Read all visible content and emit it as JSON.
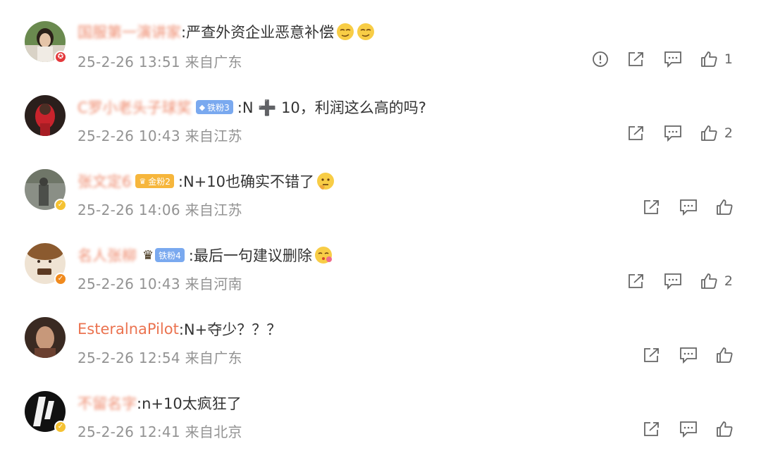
{
  "comments": [
    {
      "username": "国服第一演讲家",
      "fan_badge": "",
      "text": ":严查外资企业恶意补偿",
      "emojis": [
        "smirk",
        "smirk"
      ],
      "time": "25-2-26 13:51",
      "location": "来自广东",
      "report": true,
      "likes": "1",
      "avatar_badge": "red"
    },
    {
      "username": "C罗小老头子球奖",
      "fan_badge": "铁粉3",
      "text": ":N ➕ 10，利润这么高的吗?",
      "emojis": [],
      "time": "25-2-26 10:43",
      "location": "来自江苏",
      "report": false,
      "likes": "2",
      "avatar_badge": ""
    },
    {
      "username": "张文定6",
      "fan_badge": "金粉2",
      "text": ":N+10也确实不错了",
      "emojis": [
        "thinking"
      ],
      "time": "25-2-26 14:06",
      "location": "来自江苏",
      "report": false,
      "likes": "",
      "avatar_badge": "yellow"
    },
    {
      "username": "名人张柳",
      "fan_badge": "铁粉4",
      "text": ":最后一句建议删除",
      "emojis": [
        "kiss"
      ],
      "time": "25-2-26 10:43",
      "location": "来自河南",
      "report": false,
      "likes": "2",
      "avatar_badge": "orange"
    },
    {
      "username": "EsteralnaPilot",
      "fan_badge": "",
      "text": ":N+夺少？？？",
      "emojis": [],
      "time": "25-2-26 12:54",
      "location": "来自广东",
      "report": false,
      "likes": "",
      "avatar_badge": ""
    },
    {
      "username": "不留名字",
      "fan_badge": "",
      "text": ":n+10太疯狂了",
      "emojis": [],
      "time": "25-2-26 12:41",
      "location": "来自北京",
      "report": false,
      "likes": "",
      "avatar_badge": "yellow"
    }
  ],
  "icons": {
    "report": "report-icon",
    "share": "share-icon",
    "comment": "comment-icon",
    "like": "thumbs-up-icon"
  },
  "colors": {
    "username": "#eb7350",
    "meta": "#939393",
    "iron_fan": "#7aa9ef",
    "gold_fan": "#f6b63c"
  }
}
